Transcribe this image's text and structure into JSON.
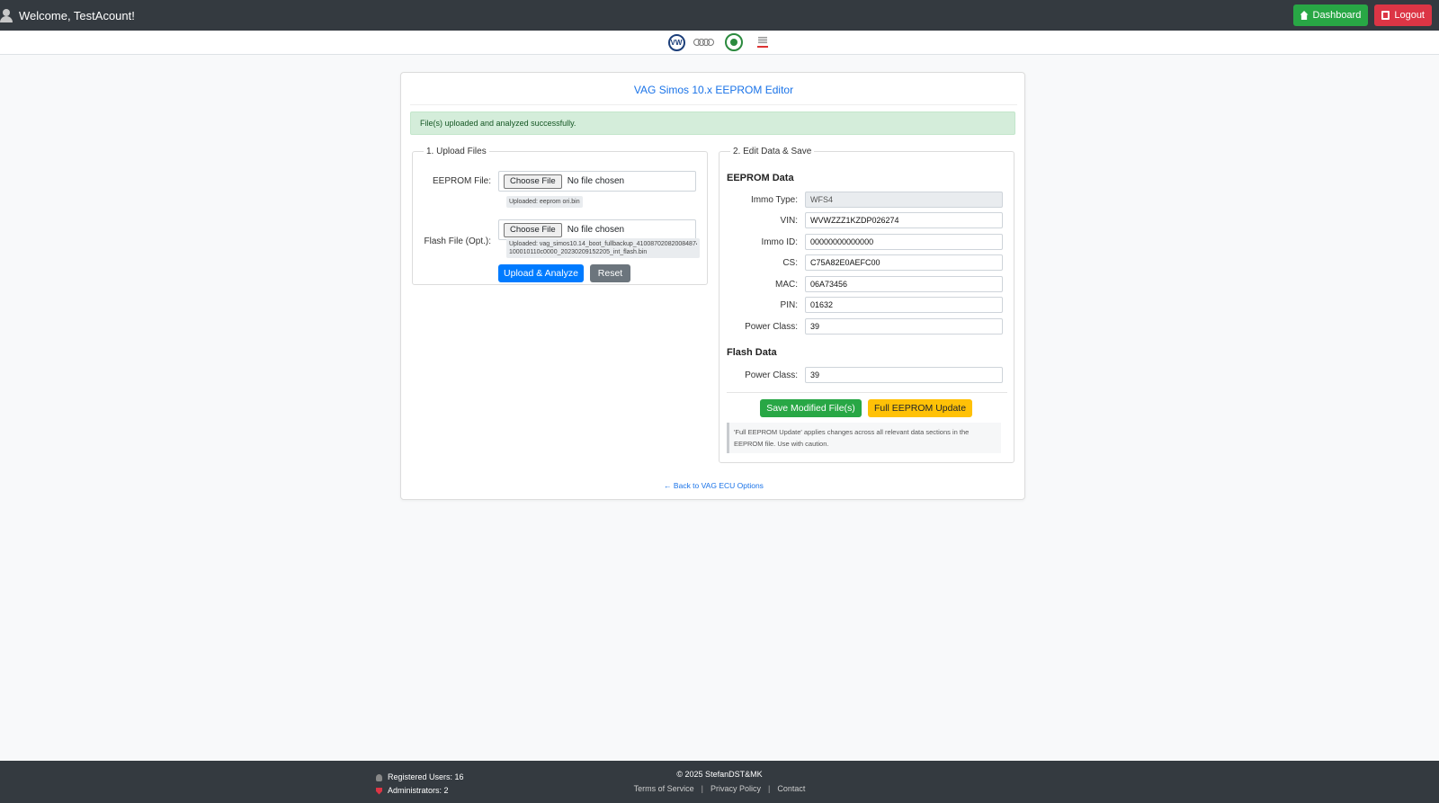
{
  "header": {
    "welcome": "Welcome, TestAcount!",
    "dashboard_label": "Dashboard",
    "logout_label": "Logout"
  },
  "brands": [
    "vw-logo",
    "audi-logo",
    "skoda-logo",
    "seat-logo"
  ],
  "card": {
    "title": "VAG Simos 10.x EEPROM Editor",
    "alert": "File(s) uploaded and analyzed successfully.",
    "upload": {
      "legend": "1. Upload Files",
      "eeprom_label": "EEPROM File:",
      "flash_label": "Flash File (Opt.):",
      "choose_label": "Choose File",
      "no_file": "No file chosen",
      "eeprom_uploaded": "Uploaded: eeprom ori.bin",
      "flash_uploaded_1": "Uploaded: vag_simos10.14_boot_fullbackup_410087020820084874",
      "flash_uploaded_2": "100010110c0000_20230209152205_int_flash.bin",
      "analyze_label": "Upload & Analyze",
      "reset_label": "Reset"
    },
    "edit": {
      "legend": "2. Edit Data & Save",
      "eeprom_heading": "EEPROM Data",
      "fields": [
        {
          "label": "Immo Type:",
          "value": "WFS4"
        },
        {
          "label": "VIN:",
          "value": "WVWZZZ1KZDP026274"
        },
        {
          "label": "Immo ID:",
          "value": "00000000000000"
        },
        {
          "label": "CS:",
          "value": "C75A82E0AEFC00"
        },
        {
          "label": "MAC:",
          "value": "06A73456"
        },
        {
          "label": "PIN:",
          "value": "01632"
        },
        {
          "label": "Power Class:",
          "value": "39"
        }
      ],
      "flash_heading": "Flash Data",
      "flash_power_label": "Power Class:",
      "flash_power_value": "39",
      "save_label": "Save Modified File(s)",
      "full_update_label": "Full EEPROM Update",
      "note_1": "'Full EEPROM Update' applies changes across all relevant data sections in the",
      "note_2": "EEPROM file. Use with caution."
    },
    "back_link": "← Back to VAG ECU Options"
  },
  "footer": {
    "registered_users": "Registered Users: 16",
    "administrators": "Administrators: 2",
    "copyright": "© 2025 StefanDST&MK",
    "terms": "Terms of Service",
    "privacy": "Privacy Policy",
    "contact": "Contact",
    "separator": "|"
  }
}
